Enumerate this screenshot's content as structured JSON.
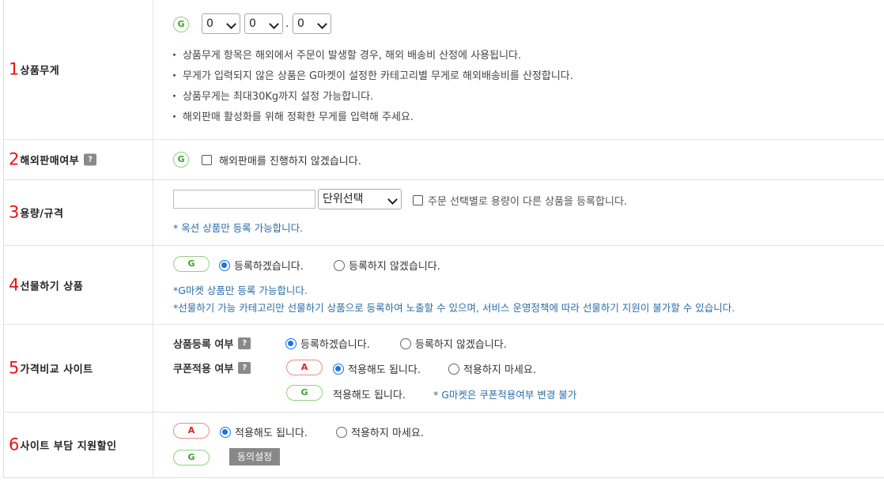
{
  "rows": {
    "weight": {
      "num": "1",
      "title": "상품무게",
      "g_badge": "G",
      "selects": [
        "0",
        "0",
        "0"
      ],
      "dot": ".",
      "bullets": [
        "상품무게 항목은 해외에서 주문이 발생할 경우, 해외 배송비 산정에 사용됩니다.",
        "무게가 입력되지 않은 상품은 G마켓이 설정한 카테고리별 무게로 해외배송비를 산정합니다.",
        "상품무게는 최대30Kg까지 설정 가능합니다.",
        "해외판매 활성화를 위해 정확한 무게를 입력해 주세요."
      ]
    },
    "overseas": {
      "num": "2",
      "title": "해외판매여부",
      "help": "?",
      "g_badge": "G",
      "checkbox_label": "해외판매를 진행하지 않겠습니다."
    },
    "volume": {
      "num": "3",
      "title": "용량/규격",
      "input_value": "",
      "unit_select": "단위선택",
      "checkbox_label": "주문 선택별로 용량이 다른 상품을 등록합니다.",
      "note": "* 옥션 상품만 등록 가능합니다."
    },
    "gift": {
      "num": "4",
      "title": "선물하기 상품",
      "g_badge": "G",
      "opt_yes": "등록하겠습니다.",
      "opt_no": "등록하지 않겠습니다.",
      "note1": "*G마켓 상품만 등록 가능합니다.",
      "note2": "*선물하기 가능 카테고리만 선물하기 상품으로 등록하여 노출할 수 있으며, 서비스 운영정책에 따라 선물하기 지원이 불가할 수 있습니다."
    },
    "price_compare": {
      "num": "5",
      "title": "가격비교 사이트",
      "reg_label": "상품등록 여부",
      "help": "?",
      "reg_yes": "등록하겠습니다.",
      "reg_no": "등록하지 않겠습니다.",
      "coupon_label": "쿠폰적용 여부",
      "a_badge": "A",
      "g_badge": "G",
      "coupon_yes": "적용해도 됩니다.",
      "coupon_no": "적용하지 마세요.",
      "g_coupon_text": "적용해도 됩니다.",
      "g_note": "* G마켓은 쿠폰적용여부 변경 불가"
    },
    "site_discount": {
      "num": "6",
      "title": "사이트 부담 지원할인",
      "a_badge": "A",
      "g_badge": "G",
      "opt_yes": "적용해도 됩니다.",
      "opt_no": "적용하지 마세요.",
      "agree_button": "동의설정"
    }
  },
  "state": {
    "gift_selected": "yes",
    "reg_selected": "yes",
    "coupon_selected": "yes",
    "site_discount_selected": "yes",
    "overseas_checked": false,
    "volume_checked": false
  },
  "colors": {
    "number_red": "#e11111",
    "g_green": "#3aa52b",
    "a_red": "#e42020",
    "note_blue": "#2a6da8",
    "radio_blue": "#1a73e8"
  }
}
